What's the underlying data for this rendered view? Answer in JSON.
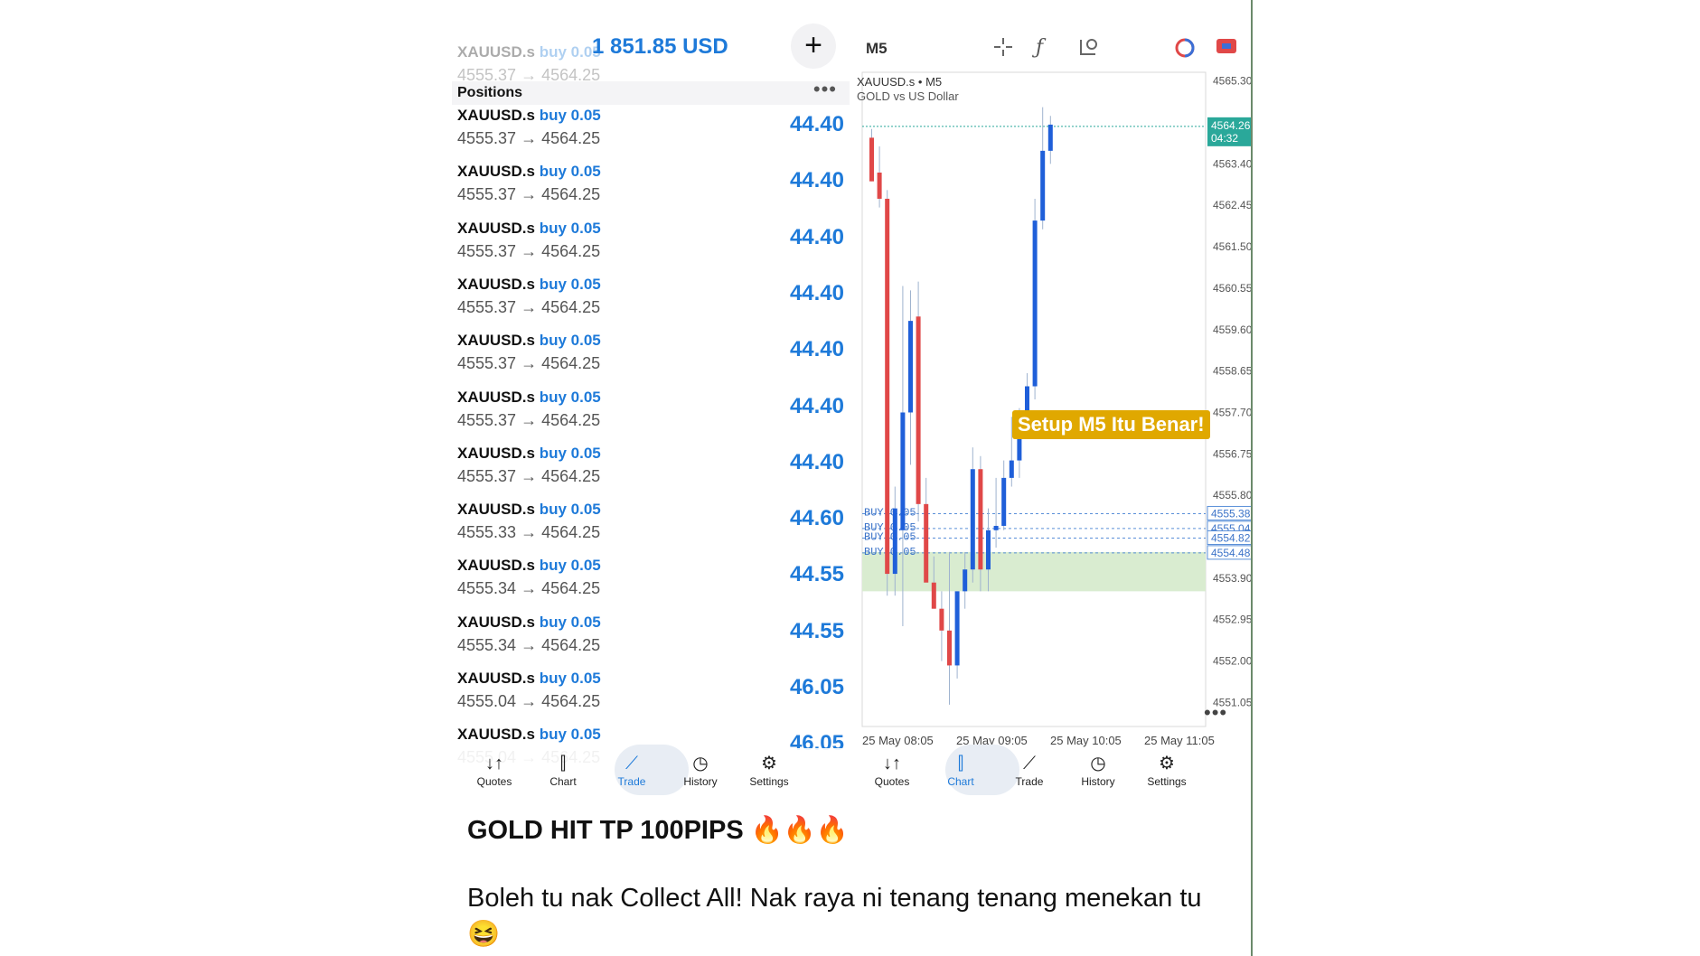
{
  "left_phone": {
    "balance": "1 851.85 USD",
    "plus_label": "+",
    "positions_title": "Positions",
    "more_label": "•••",
    "faded_top_row": {
      "symbol": "XAUUSD.s",
      "side": "buy 0.05",
      "prices": "4555.37 → 4564.25"
    },
    "positions": [
      {
        "symbol": "XAUUSD.s",
        "side": "buy 0.05",
        "prices": "4555.37 → 4564.25",
        "pl": "44.40"
      },
      {
        "symbol": "XAUUSD.s",
        "side": "buy 0.05",
        "prices": "4555.37 → 4564.25",
        "pl": "44.40"
      },
      {
        "symbol": "XAUUSD.s",
        "side": "buy 0.05",
        "prices": "4555.37 → 4564.25",
        "pl": "44.40"
      },
      {
        "symbol": "XAUUSD.s",
        "side": "buy 0.05",
        "prices": "4555.37 → 4564.25",
        "pl": "44.40"
      },
      {
        "symbol": "XAUUSD.s",
        "side": "buy 0.05",
        "prices": "4555.37 → 4564.25",
        "pl": "44.40"
      },
      {
        "symbol": "XAUUSD.s",
        "side": "buy 0.05",
        "prices": "4555.37 → 4564.25",
        "pl": "44.40"
      },
      {
        "symbol": "XAUUSD.s",
        "side": "buy 0.05",
        "prices": "4555.37 → 4564.25",
        "pl": "44.40"
      },
      {
        "symbol": "XAUUSD.s",
        "side": "buy 0.05",
        "prices": "4555.33 → 4564.25",
        "pl": "44.60"
      },
      {
        "symbol": "XAUUSD.s",
        "side": "buy 0.05",
        "prices": "4555.34 → 4564.25",
        "pl": "44.55"
      },
      {
        "symbol": "XAUUSD.s",
        "side": "buy 0.05",
        "prices": "4555.34 → 4564.25",
        "pl": "44.55"
      },
      {
        "symbol": "XAUUSD.s",
        "side": "buy 0.05",
        "prices": "4555.04 → 4564.25",
        "pl": "46.05"
      },
      {
        "symbol": "XAUUSD.s",
        "side": "buy 0.05",
        "prices": "4555.04 → 4564.25",
        "pl": "46.05"
      }
    ],
    "tabs": [
      {
        "label": "Quotes",
        "icon": "↓↑"
      },
      {
        "label": "Chart",
        "icon": "⫿"
      },
      {
        "label": "Trade",
        "icon": "⟋"
      },
      {
        "label": "History",
        "icon": "◷"
      },
      {
        "label": "Settings",
        "icon": "⚙"
      }
    ],
    "active_tab": "Trade"
  },
  "right_phone": {
    "timeframe": "M5",
    "tool_icons": [
      "crosshair-icon",
      "function-icon",
      "objects-icon",
      "trade-circle-icon",
      "broker-icon"
    ],
    "chart_symbol": "XAUUSD.s • M5",
    "chart_description": "GOLD vs US Dollar",
    "overlay_text": "Setup M5 Itu Benar!",
    "more_label": "•••",
    "tabs": [
      {
        "label": "Quotes",
        "icon": "↓↑"
      },
      {
        "label": "Chart",
        "icon": "⫿"
      },
      {
        "label": "Trade",
        "icon": "⟋"
      },
      {
        "label": "History",
        "icon": "◷"
      },
      {
        "label": "Settings",
        "icon": "⚙"
      }
    ],
    "active_tab": "Chart"
  },
  "chart_data": {
    "type": "candlestick",
    "symbol": "XAUUSD.s",
    "timeframe": "M5",
    "ylim": [
      4550.5,
      4565.5
    ],
    "y_ticks": [
      "4565.30",
      "4563.40",
      "4562.45",
      "4561.50",
      "4560.55",
      "4559.60",
      "4558.65",
      "4557.70",
      "4556.75",
      "4555.80",
      "4553.90",
      "4552.95",
      "4552.00",
      "4551.05"
    ],
    "x_ticks": [
      "25 May 08:05",
      "25 May 09:05",
      "25 May 10:05",
      "25 May 11:05"
    ],
    "current_price": "4564.26",
    "countdown": "04:32",
    "position_lines": [
      "4555.38",
      "4555.04",
      "4554.82",
      "4554.48"
    ],
    "order_labels": [
      "BUY 0.05",
      "BUY 0.05",
      "BUY 0.05",
      "BUY 0.05"
    ],
    "tp_zone": [
      4553.6,
      4554.5
    ],
    "candles": [
      {
        "o": 4564.0,
        "h": 4564.2,
        "l": 4563.0,
        "c": 4563.0
      },
      {
        "o": 4563.2,
        "h": 4563.8,
        "l": 4562.4,
        "c": 4562.6
      },
      {
        "o": 4562.6,
        "h": 4562.8,
        "l": 4553.5,
        "c": 4554.0
      },
      {
        "o": 4554.0,
        "h": 4556.0,
        "l": 4553.5,
        "c": 4555.5
      },
      {
        "o": 4555.0,
        "h": 4560.6,
        "l": 4552.8,
        "c": 4557.7
      },
      {
        "o": 4557.7,
        "h": 4560.5,
        "l": 4556.5,
        "c": 4559.8
      },
      {
        "o": 4559.9,
        "h": 4560.7,
        "l": 4555.2,
        "c": 4555.6
      },
      {
        "o": 4555.6,
        "h": 4556.2,
        "l": 4554.0,
        "c": 4553.8
      },
      {
        "o": 4553.8,
        "h": 4554.4,
        "l": 4553.2,
        "c": 4553.2
      },
      {
        "o": 4553.2,
        "h": 4553.6,
        "l": 4552.0,
        "c": 4552.7
      },
      {
        "o": 4552.7,
        "h": 4554.5,
        "l": 4551.0,
        "c": 4551.9
      },
      {
        "o": 4551.9,
        "h": 4553.6,
        "l": 4551.6,
        "c": 4553.6
      },
      {
        "o": 4553.6,
        "h": 4554.5,
        "l": 4553.2,
        "c": 4554.1
      },
      {
        "o": 4554.1,
        "h": 4556.9,
        "l": 4553.8,
        "c": 4556.4
      },
      {
        "o": 4556.4,
        "h": 4556.7,
        "l": 4553.6,
        "c": 4554.1
      },
      {
        "o": 4554.1,
        "h": 4555.5,
        "l": 4553.6,
        "c": 4555.0
      },
      {
        "o": 4555.0,
        "h": 4556.2,
        "l": 4554.6,
        "c": 4555.1
      },
      {
        "o": 4555.1,
        "h": 4556.6,
        "l": 4555.0,
        "c": 4556.2
      },
      {
        "o": 4556.2,
        "h": 4557.6,
        "l": 4556.0,
        "c": 4556.6
      },
      {
        "o": 4556.6,
        "h": 4557.8,
        "l": 4556.2,
        "c": 4557.4
      },
      {
        "o": 4557.4,
        "h": 4558.6,
        "l": 4557.2,
        "c": 4558.3
      },
      {
        "o": 4558.3,
        "h": 4562.6,
        "l": 4558.0,
        "c": 4562.1
      },
      {
        "o": 4562.1,
        "h": 4564.7,
        "l": 4561.9,
        "c": 4563.7
      },
      {
        "o": 4563.7,
        "h": 4564.5,
        "l": 4563.4,
        "c": 4564.3
      }
    ]
  },
  "caption": {
    "title": "GOLD HIT TP 100PIPS 🔥🔥🔥",
    "body": "Boleh tu nak Collect All! Nak raya ni tenang tenang menekan tu 😆"
  }
}
